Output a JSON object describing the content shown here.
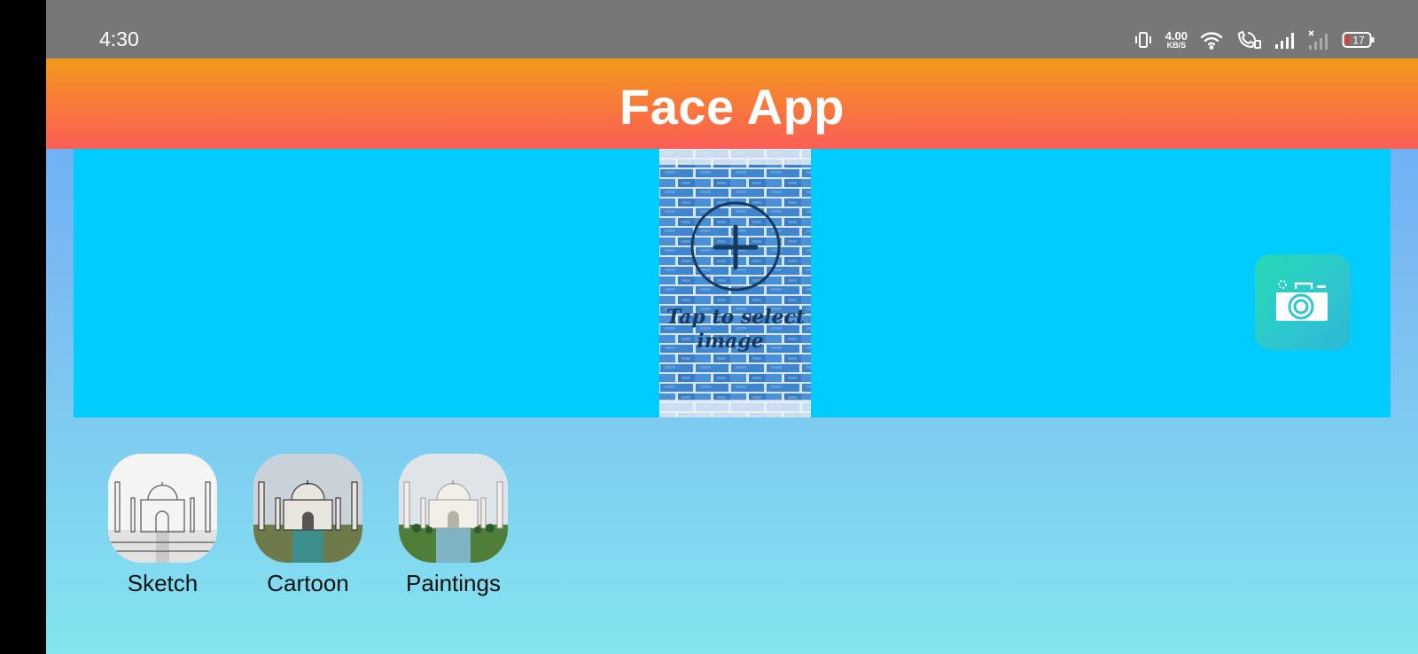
{
  "status_bar": {
    "time": "4:30",
    "net_speed_value": "4.00",
    "net_speed_unit": "KB/S",
    "battery": "17",
    "icons": [
      "vibrate-icon",
      "net-speed",
      "wifi-icon",
      "wifi-call-icon",
      "signal-icon",
      "signal-no-service-icon",
      "battery-icon"
    ]
  },
  "app_bar": {
    "title": "Face App"
  },
  "image_picker": {
    "label_line1": "Tap to select",
    "label_line2": "image",
    "icon": "plus-circle-icon"
  },
  "camera_button": {
    "icon": "camera-icon"
  },
  "filters": [
    {
      "label": "Sketch",
      "style": "sketch"
    },
    {
      "label": "Cartoon",
      "style": "cartoon"
    },
    {
      "label": "Paintings",
      "style": "painting"
    }
  ],
  "colors": {
    "status_bar": "#777777",
    "app_bar_top": "#f29a1a",
    "app_bar_bottom": "#fc5f55",
    "image_area": "#00ccff",
    "camera_button": "#25d9b4",
    "background_top": "#61a7f6",
    "background_bottom": "#84e4ef"
  }
}
